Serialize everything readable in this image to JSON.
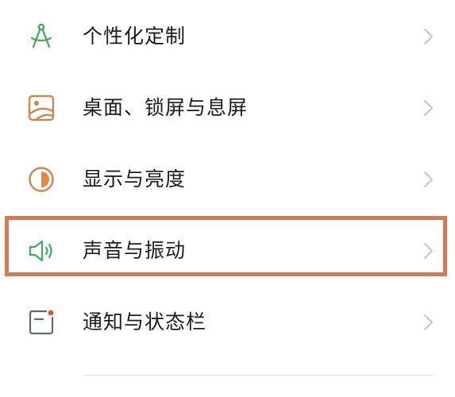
{
  "settings": {
    "items": [
      {
        "label": "个性化定制",
        "icon": "compass-icon"
      },
      {
        "label": "桌面、锁屏与息屏",
        "icon": "wallpaper-icon"
      },
      {
        "label": "显示与亮度",
        "icon": "brightness-icon"
      },
      {
        "label": "声音与振动",
        "icon": "speaker-icon"
      },
      {
        "label": "通知与状态栏",
        "icon": "notification-icon"
      }
    ]
  },
  "colors": {
    "highlight_border": "#d47a55",
    "icon_green": "#3fa85b",
    "icon_orange": "#c8884e",
    "chevron": "#c4c4c4",
    "text": "#1c1c1c"
  }
}
